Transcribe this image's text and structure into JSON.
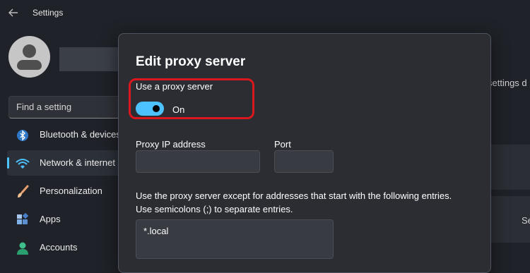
{
  "window": {
    "title": "Settings"
  },
  "search": {
    "placeholder": "Find a setting"
  },
  "sidebar": {
    "items": [
      {
        "label": "Bluetooth & devices",
        "icon": "bluetooth-icon"
      },
      {
        "label": "Network & internet",
        "icon": "wifi-icon",
        "active": true
      },
      {
        "label": "Personalization",
        "icon": "brush-icon"
      },
      {
        "label": "Apps",
        "icon": "apps-icon"
      },
      {
        "label": "Accounts",
        "icon": "person-icon"
      }
    ]
  },
  "background": {
    "right_text": "settings d",
    "right_button": "Se"
  },
  "dialog": {
    "title": "Edit proxy server",
    "toggle": {
      "label": "Use a proxy server",
      "state": "On"
    },
    "proxy_ip": {
      "label": "Proxy IP address",
      "value": ""
    },
    "port": {
      "label": "Port",
      "value": ""
    },
    "exceptions": {
      "description_line1": "Use the proxy server except for addresses that start with the following entries.",
      "description_line2": "Use semicolons (;) to separate entries.",
      "value": "*.local"
    }
  },
  "colors": {
    "accent": "#4cc2ff",
    "highlight": "#d8171f",
    "background": "#1f2228",
    "dialog": "#2b2d33"
  }
}
